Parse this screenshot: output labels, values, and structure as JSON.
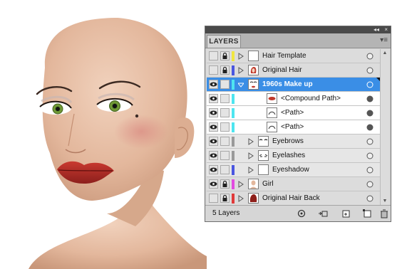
{
  "panel": {
    "tab_title": "LAYERS",
    "collapse_label": "◂◂",
    "close_label": "×",
    "menu_label": "▾≡",
    "footer_count": "5 Layers"
  },
  "colors": {
    "selection": "#3a8ee6",
    "cyan_layer": "#4ee5f0",
    "yellow_layer": "#f0e640",
    "blue_layer": "#4a56e0",
    "gray_layer": "#9a9a9a",
    "magenta_layer": "#e24be0",
    "red_layer": "#e03a3a"
  },
  "layers": [
    {
      "name": "Hair Template",
      "visible": false,
      "locked": true,
      "color": "#f0e640",
      "level": 0,
      "expanded": false,
      "selected": false,
      "thumb_icon": "blank-thumb-icon"
    },
    {
      "name": "Original Hair",
      "visible": false,
      "locked": true,
      "color": "#4a56e0",
      "level": 0,
      "expanded": false,
      "selected": false,
      "thumb_icon": "hair-thumb-icon"
    },
    {
      "name": "1960s Make up",
      "visible": true,
      "locked": false,
      "color": "#4ee5f0",
      "level": 0,
      "expanded": true,
      "selected": true,
      "thumb_icon": "face-thumb-icon"
    },
    {
      "name": "<Compound Path>",
      "visible": true,
      "locked": false,
      "color": "#4ee5f0",
      "level": 2,
      "expanded": null,
      "selected": false,
      "thumb_icon": "lips-thumb-icon"
    },
    {
      "name": "<Path>",
      "visible": true,
      "locked": false,
      "color": "#4ee5f0",
      "level": 2,
      "expanded": null,
      "selected": false,
      "thumb_icon": "path-thumb-icon"
    },
    {
      "name": "<Path>",
      "visible": true,
      "locked": false,
      "color": "#4ee5f0",
      "level": 2,
      "expanded": null,
      "selected": false,
      "thumb_icon": "path-thumb-icon"
    },
    {
      "name": "Eyebrows",
      "visible": true,
      "locked": false,
      "color": "#9a9a9a",
      "level": 1,
      "expanded": false,
      "selected": false,
      "thumb_icon": "eyebrows-thumb-icon"
    },
    {
      "name": "Eyelashes",
      "visible": true,
      "locked": false,
      "color": "#9a9a9a",
      "level": 1,
      "expanded": false,
      "selected": false,
      "thumb_icon": "eyelashes-thumb-icon"
    },
    {
      "name": "Eyeshadow",
      "visible": true,
      "locked": false,
      "color": "#4a56e0",
      "level": 1,
      "expanded": false,
      "selected": false,
      "thumb_icon": "blank-thumb-icon"
    },
    {
      "name": "Girl",
      "visible": true,
      "locked": true,
      "color": "#e24be0",
      "level": 0,
      "expanded": false,
      "selected": false,
      "thumb_icon": "girl-thumb-icon"
    },
    {
      "name": "Original Hair Back",
      "visible": false,
      "locked": true,
      "color": "#e03a3a",
      "level": 0,
      "expanded": false,
      "selected": false,
      "thumb_icon": "hair-back-thumb-icon"
    }
  ],
  "footer_buttons": [
    "locate-object-icon",
    "make-clipping-mask-icon",
    "new-sublayer-icon",
    "new-layer-icon",
    "trash-icon"
  ]
}
